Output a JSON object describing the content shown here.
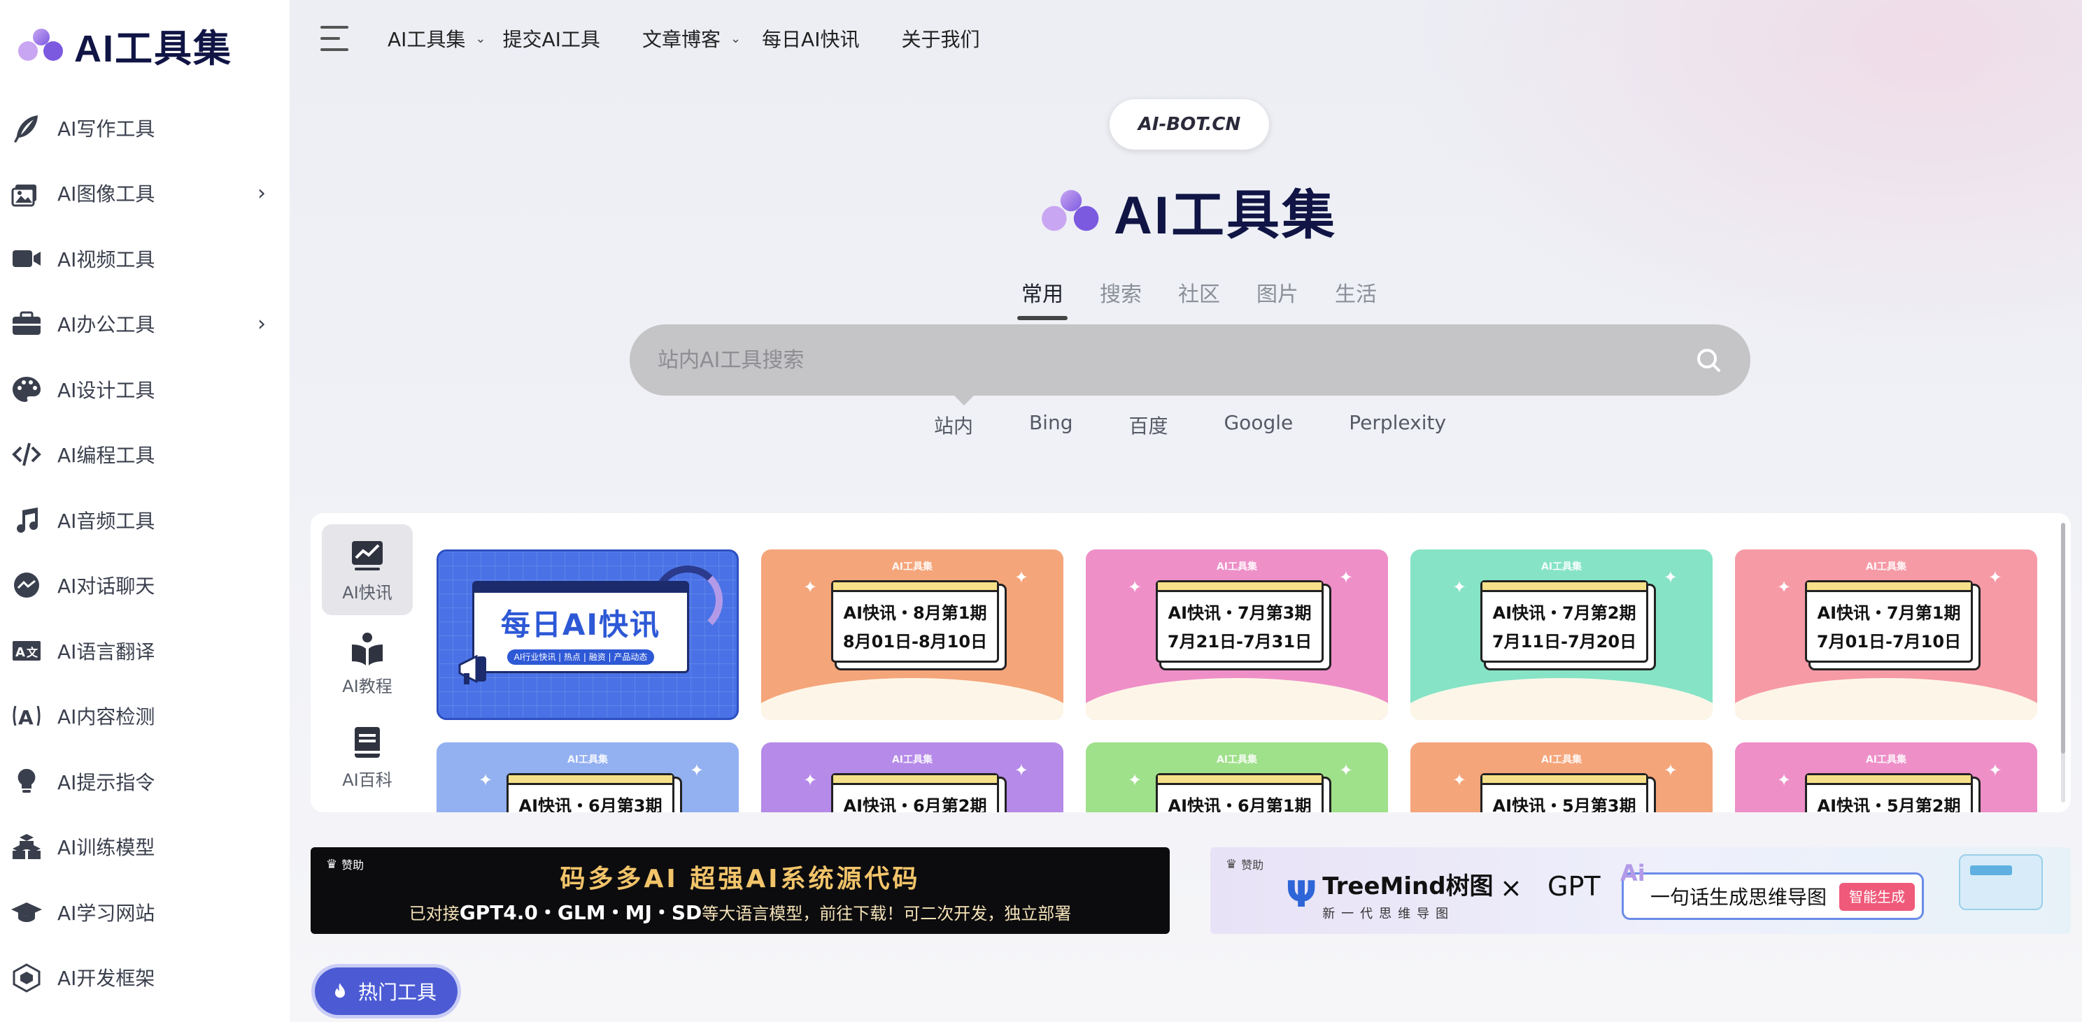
{
  "brand": {
    "name": "AI工具集"
  },
  "sidebar": {
    "items": [
      {
        "label": "AI写作工具",
        "icon": "feather-icon",
        "has_children": false
      },
      {
        "label": "AI图像工具",
        "icon": "images-icon",
        "has_children": true
      },
      {
        "label": "AI视频工具",
        "icon": "video-camera-icon",
        "has_children": false
      },
      {
        "label": "AI办公工具",
        "icon": "briefcase-icon",
        "has_children": true
      },
      {
        "label": "AI设计工具",
        "icon": "palette-icon",
        "has_children": false
      },
      {
        "label": "AI编程工具",
        "icon": "code-icon",
        "has_children": false
      },
      {
        "label": "AI音频工具",
        "icon": "music-note-icon",
        "has_children": false
      },
      {
        "label": "AI对话聊天",
        "icon": "chat-bubble-icon",
        "has_children": false
      },
      {
        "label": "AI语言翻译",
        "icon": "translate-icon",
        "has_children": false
      },
      {
        "label": "AI内容检测",
        "icon": "detect-icon",
        "has_children": false
      },
      {
        "label": "AI提示指令",
        "icon": "lightbulb-icon",
        "has_children": false
      },
      {
        "label": "AI训练模型",
        "icon": "cubes-icon",
        "has_children": false
      },
      {
        "label": "AI学习网站",
        "icon": "graduation-cap-icon",
        "has_children": false
      },
      {
        "label": "AI开发框架",
        "icon": "framework-icon",
        "has_children": false
      }
    ]
  },
  "topnav": {
    "items": [
      {
        "label": "AI工具集",
        "has_dropdown": true
      },
      {
        "label": "提交AI工具",
        "has_dropdown": false
      },
      {
        "label": "文章博客",
        "has_dropdown": true
      },
      {
        "label": "每日AI快讯",
        "has_dropdown": false
      },
      {
        "label": "关于我们",
        "has_dropdown": false
      }
    ]
  },
  "hero": {
    "badge": "AI-BOT.CN",
    "title": "AI工具集"
  },
  "search": {
    "tabs": [
      "常用",
      "搜索",
      "社区",
      "图片",
      "生活"
    ],
    "active_tab": "常用",
    "placeholder": "站内AI工具搜索",
    "engines": [
      "站内",
      "Bing",
      "百度",
      "Google",
      "Perplexity"
    ],
    "active_engine": "站内"
  },
  "news_panel": {
    "tabs": [
      {
        "label": "AI快讯",
        "icon": "chart-line-icon",
        "active": true
      },
      {
        "label": "AI教程",
        "icon": "book-open-icon",
        "active": false
      },
      {
        "label": "AI百科",
        "icon": "book-icon",
        "active": false
      }
    ],
    "featured": {
      "title": "每日AI快讯",
      "subtitle": "AI行业快讯 | 热点 | 融资 | 产品动态",
      "color": "#4a72e6"
    },
    "cards": [
      {
        "title": "AI快讯・8月第1期",
        "date": "8月01日-8月10日",
        "color": "#f4a57a"
      },
      {
        "title": "AI快讯・7月第3期",
        "date": "7月21日-7月31日",
        "color": "#ee8fc8"
      },
      {
        "title": "AI快讯・7月第2期",
        "date": "7月11日-7月20日",
        "color": "#86e3c6"
      },
      {
        "title": "AI快讯・7月第1期",
        "date": "7月01日-7月10日",
        "color": "#f69aa6"
      },
      {
        "title": "AI快讯・6月第3期",
        "date": "",
        "color": "#93b0f0"
      },
      {
        "title": "AI快讯・6月第2期",
        "date": "",
        "color": "#b58ae8"
      },
      {
        "title": "AI快讯・6月第1期",
        "date": "",
        "color": "#9fe08a"
      },
      {
        "title": "AI快讯・5月第3期",
        "date": "",
        "color": "#f4a57a"
      },
      {
        "title": "AI快讯・5月第2期",
        "date": "",
        "color": "#ee8fc8"
      }
    ],
    "card_header": "AI工具集"
  },
  "ads": {
    "sponsor_label": "赞助",
    "left": {
      "headline": "码多多AI 超强AI系统源代码",
      "sub_prefix": "已对接",
      "sub_bold": "GPT4.0・GLM・MJ・SD",
      "sub_suffix": "等大语言模型，前往下载！可二次开发，独立部署"
    },
    "right": {
      "brand": "TreeMind树图",
      "brand_sub": "新一代思维导图",
      "times": "×",
      "partner": "GPT",
      "ai_mark": "Ai",
      "prompt": "一句话生成思维导图",
      "button": "智能生成"
    }
  },
  "hot_tools": {
    "label": "热门工具",
    "icon": "flame-icon"
  }
}
